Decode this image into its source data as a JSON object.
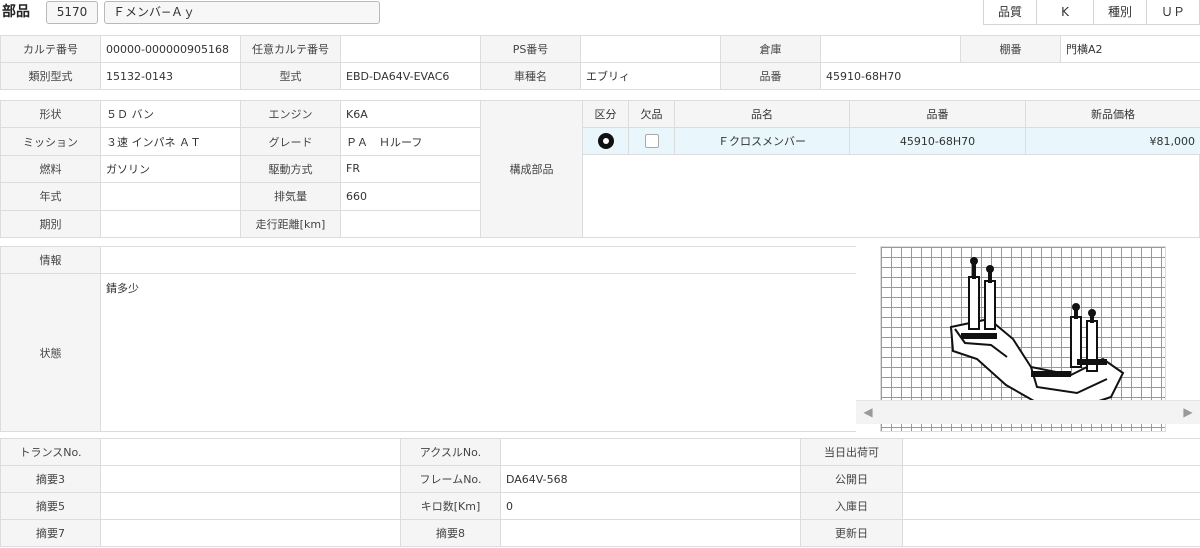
{
  "header": {
    "title": "部品",
    "code": "5170",
    "name": "Ｆメンバ−Ａｙ",
    "quality_label": "品質",
    "quality_value": "K",
    "type_label": "種別",
    "type_value": "ＵＰ"
  },
  "row1": {
    "karte_no_label": "カルテ番号",
    "karte_no": "00000-000000905168",
    "opt_karte_label": "任意カルテ番号",
    "opt_karte": "",
    "ps_label": "PS番号",
    "ps": "",
    "warehouse_label": "倉庫",
    "warehouse": "",
    "shelf_label": "棚番",
    "shelf": "門横A2"
  },
  "row2": {
    "class_model_label": "類別型式",
    "class_model": "15132-0143",
    "model_label": "型式",
    "model": "EBD-DA64V-EVAC6",
    "car_name_label": "車種名",
    "car_name": "エブリィ",
    "part_no_label": "品番",
    "part_no": "45910-68H70"
  },
  "spec": {
    "shape_label": "形状",
    "shape": "５Ｄ バン",
    "engine_label": "エンジン",
    "engine": "K6A",
    "mission_label": "ミッション",
    "mission": "３速 インパネ ＡＴ",
    "grade_label": "グレード",
    "grade": "ＰＡ　Ｈルーフ",
    "fuel_label": "燃料",
    "fuel": "ガソリン",
    "drive_label": "駆動方式",
    "drive": "FR",
    "year_label": "年式",
    "year": "",
    "displacement_label": "排気量",
    "displacement": "660",
    "period_label": "期別",
    "period": "",
    "mileage_label": "走行距離[km]",
    "mileage": "",
    "components_label": "構成部品"
  },
  "parts_table": {
    "headers": [
      "区分",
      "欠品",
      "品名",
      "品番",
      "新品価格"
    ],
    "rows": [
      {
        "name": "Ｆクロスメンバー",
        "number": "45910-68H70",
        "price": "¥81,000"
      }
    ]
  },
  "info": {
    "info_label": "情報",
    "info": "",
    "condition_label": "状態",
    "condition": "錆多少"
  },
  "bottom": {
    "trans_label": "トランスNo.",
    "trans": "",
    "axle_label": "アクスルNo.",
    "axle": "",
    "same_day_label": "当日出荷可",
    "same_day": "",
    "summary3_label": "摘要3",
    "summary3": "",
    "frame_label": "フレームNo.",
    "frame": "DA64V-568",
    "public_label": "公開日",
    "public": "",
    "summary5_label": "摘要5",
    "summary5": "",
    "km_label": "キロ数[Km]",
    "km": "0",
    "stock_label": "入庫日",
    "stock": "",
    "summary7_label": "摘要7",
    "summary7": "",
    "summary8_label": "摘要8",
    "summary8": "",
    "update_label": "更新日",
    "update": ""
  },
  "icons": {
    "category": "disc-icon",
    "missing": "checkbox-icon",
    "scroll_left": "chevron-left-icon",
    "scroll_right": "chevron-right-icon"
  }
}
